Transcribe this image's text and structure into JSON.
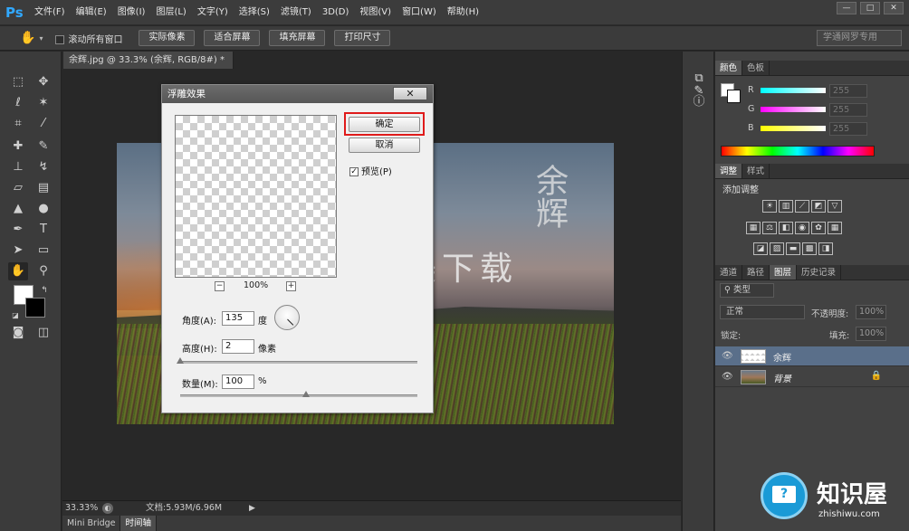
{
  "app": {
    "logo": "Ps",
    "menu": [
      "文件(F)",
      "编辑(E)",
      "图像(I)",
      "图层(L)",
      "文字(Y)",
      "选择(S)",
      "滤镜(T)",
      "3D(D)",
      "视图(V)",
      "窗口(W)",
      "帮助(H)"
    ],
    "window_controls": [
      "—",
      "□",
      "✕"
    ]
  },
  "options_bar": {
    "tool_icon": "hand-icon",
    "scroll_all_label": "滚动所有窗口",
    "buttons": [
      "实际像素",
      "适合屏幕",
      "填充屏幕",
      "打印尺寸"
    ],
    "workspace": "学通网罗专用"
  },
  "document": {
    "tab_title": "余辉.jpg @ 33.3% (余辉, RGB/8#) *",
    "tab_close": "×",
    "zoom": "33.33%",
    "doc_size": "文档:5.93M/6.96M"
  },
  "watermarks": {
    "vertical": "余辉",
    "horizontal": "完美下载"
  },
  "bottom_tabs": [
    "Mini Bridge",
    "时间轴"
  ],
  "dialog": {
    "title": "浮雕效果",
    "close": "✕",
    "ok": "确定",
    "cancel": "取消",
    "preview_label": "预览(P)",
    "preview_checked": true,
    "zoom_minus": "−",
    "zoom_plus": "+",
    "zoom_level": "100%",
    "angle_label": "角度(A):",
    "angle_value": "135",
    "angle_unit": "度",
    "height_label": "高度(H):",
    "height_value": "2",
    "height_unit": "像素",
    "amount_label": "数量(M):",
    "amount_value": "100",
    "amount_unit": "%",
    "height_slider_fraction": 0.0,
    "amount_slider_fraction": 0.53
  },
  "color_panel": {
    "tabs": [
      "颜色",
      "色板"
    ],
    "channels": [
      {
        "label": "R",
        "value": "255",
        "color": "#00ffff"
      },
      {
        "label": "G",
        "value": "255",
        "color": "#ff00ff"
      },
      {
        "label": "B",
        "value": "255",
        "color": "#ffff00"
      }
    ]
  },
  "adjustments_panel": {
    "tabs": [
      "调整",
      "样式"
    ],
    "title": "添加调整"
  },
  "layers_panel": {
    "tabs": [
      "通道",
      "路径",
      "图层",
      "历史记录"
    ],
    "filter_kind": "类型",
    "blend_mode": "正常",
    "opacity_label": "不透明度:",
    "opacity_value": "100%",
    "lock_label": "锁定:",
    "fill_label": "填充:",
    "fill_value": "100%",
    "layers": [
      {
        "name": "余辉",
        "selected": true,
        "locked": false
      },
      {
        "name": "背景",
        "selected": false,
        "locked": true
      }
    ]
  },
  "brand": {
    "name": "知识屋",
    "url": "zhishiwu.com"
  },
  "colors": {
    "accent_ps": "#31a8ff",
    "highlight": "#e01b1b",
    "brand": "#1a9ad6"
  }
}
